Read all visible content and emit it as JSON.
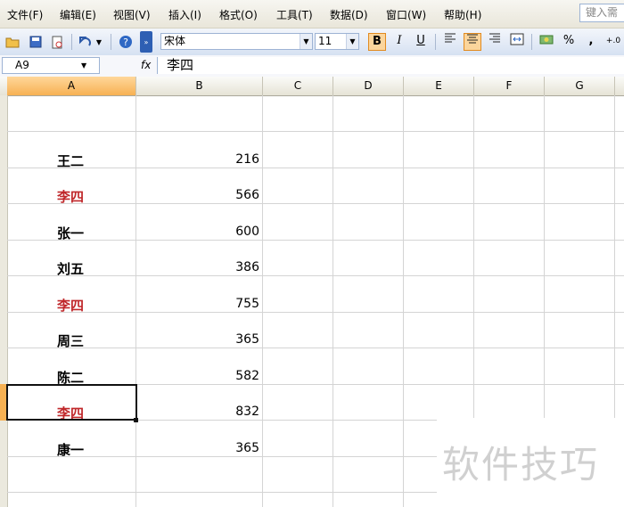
{
  "menu": [
    "文件(F)",
    "编辑(E)",
    "视图(V)",
    "插入(I)",
    "格式(O)",
    "工具(T)",
    "数据(D)",
    "窗口(W)",
    "帮助(H)"
  ],
  "help_box": "键入需",
  "toolbar": {
    "font_name": "宋体",
    "font_size": "11",
    "bold": "B",
    "italic": "I",
    "underline": "U",
    "percent": "%",
    "comma": ","
  },
  "formula_bar": {
    "name_box": "A9",
    "fx": "fx",
    "content": "李四"
  },
  "columns": [
    "A",
    "B",
    "C",
    "D",
    "E",
    "F",
    "G"
  ],
  "selected_column": "A",
  "rows": [
    {
      "name": "王二",
      "value": "216",
      "highlight": false
    },
    {
      "name": "李四",
      "value": "566",
      "highlight": true
    },
    {
      "name": "张一",
      "value": "600",
      "highlight": false
    },
    {
      "name": "刘五",
      "value": "386",
      "highlight": false
    },
    {
      "name": "李四",
      "value": "755",
      "highlight": true
    },
    {
      "name": "周三",
      "value": "365",
      "highlight": false
    },
    {
      "name": "陈二",
      "value": "582",
      "highlight": false
    },
    {
      "name": "李四",
      "value": "832",
      "highlight": true
    },
    {
      "name": "康一",
      "value": "365",
      "highlight": false
    }
  ],
  "colors": {
    "highlight_text": "#c0282b",
    "selection": "#f7b153"
  },
  "watermark": "软件技巧"
}
